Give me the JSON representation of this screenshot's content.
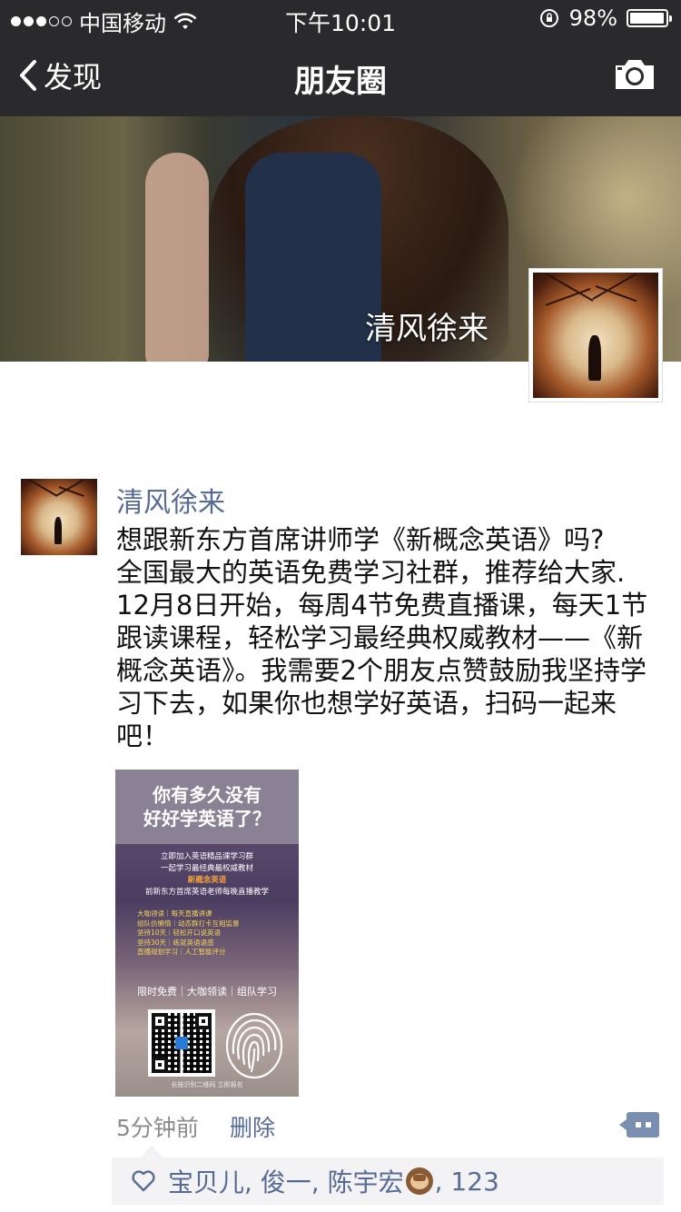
{
  "status_bar": {
    "carrier": "中国移动",
    "time": "下午10:01",
    "battery": "98%",
    "battery_level": 0.98,
    "signal_bars_filled": 3,
    "signal_bars_total": 5
  },
  "nav": {
    "back_label": "发现",
    "title": "朋友圈",
    "camera_icon": "camera-icon"
  },
  "cover": {
    "user_name": "清风徐来"
  },
  "post": {
    "author": "清风徐来",
    "text": "想跟新东方首席讲师学《新概念英语》吗?\n全国最大的英语免费学习社群，推荐给大家.\n12月8日开始，每周4节免费直播课，每天1节跟读课程，轻松学习最经典权威教材——《新概念英语》。我需要2个朋友点赞鼓励我坚持学习下去，如果你也想学好英语，扫码一起来吧！",
    "image": {
      "headline_1": "你有多久没有",
      "headline_2": "好好学英语了？",
      "sub_1": "立即加入英语精品课学习群",
      "sub_2": "一起学习最经典最权威教材",
      "sub_3": "新概念英语",
      "sub_4": "前新东方首席英语老师每晚直播教学",
      "features": [
        "大咖领读｜每天直播讲课",
        "组队仿懒惰｜动态群打卡互相监督",
        "坚持10天｜轻松开口说英语",
        "坚持30天｜练就英语语感",
        "直播规划学习｜人工智能评分"
      ],
      "tags": "限时免费｜大咖领读｜组队学习",
      "footer": "长按识别二维码 立即报名"
    },
    "time_ago": "5分钟前",
    "delete_label": "删除",
    "likes": {
      "names": "宝贝儿, 俊一, 陈宇宏",
      "trailing": ", 123"
    }
  },
  "colors": {
    "nav_bg": "#2a2a2c",
    "link_blue": "#576b95",
    "likes_bg": "#f3f3f5",
    "comment_button": "#7a8fb0"
  }
}
